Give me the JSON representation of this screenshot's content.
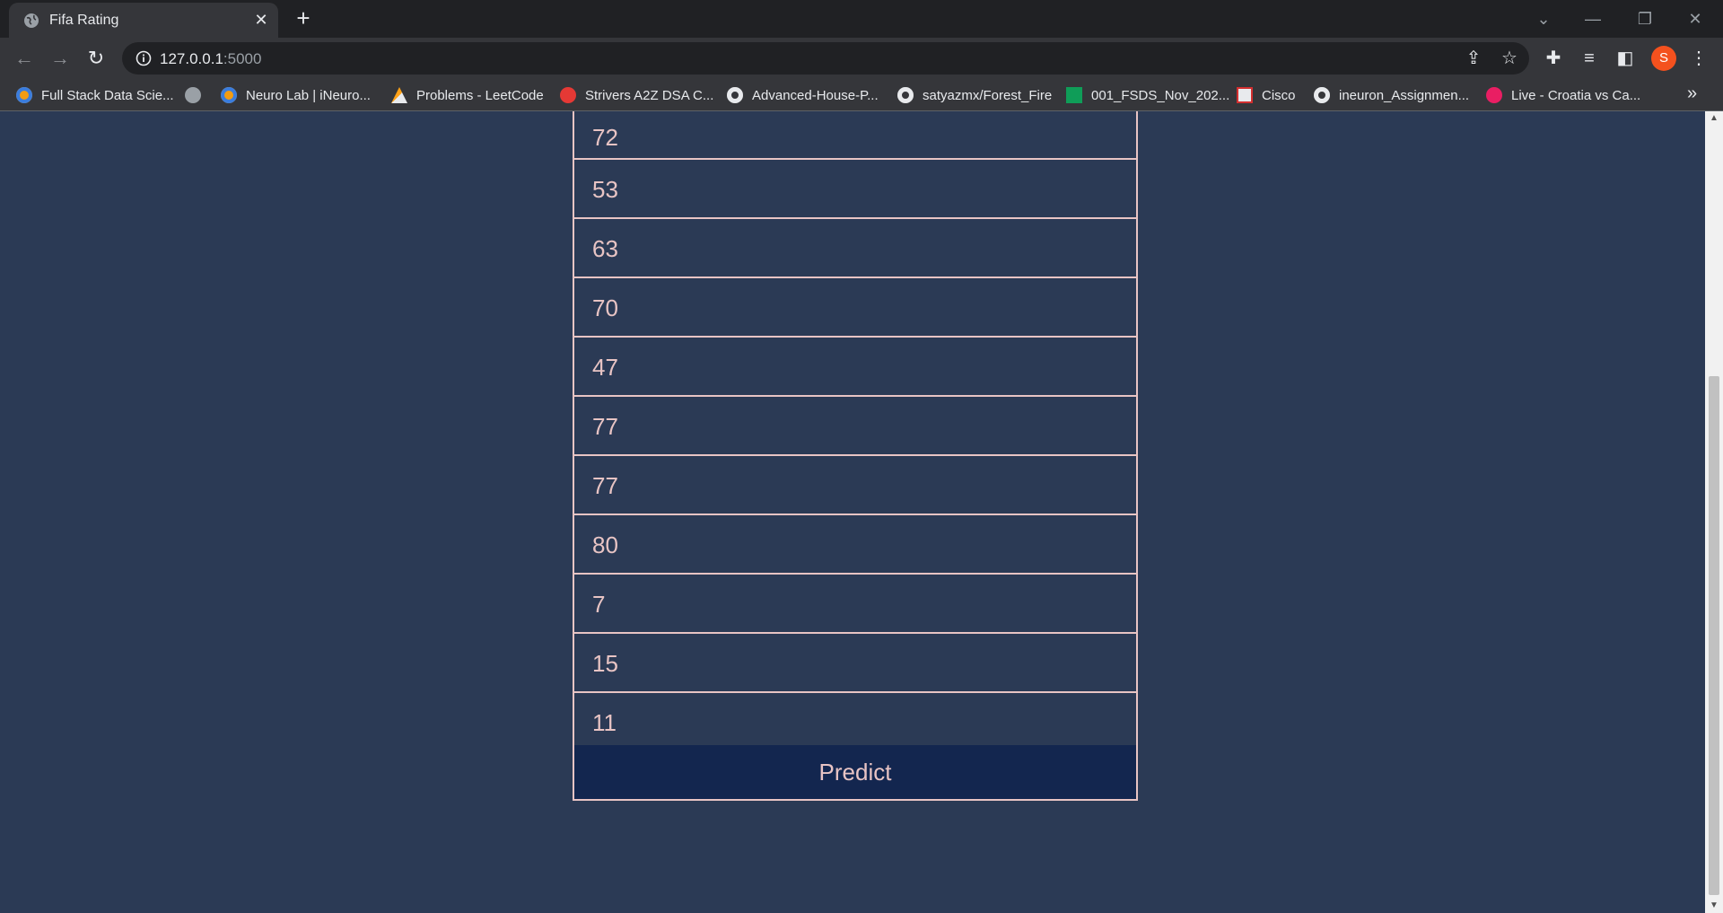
{
  "browser": {
    "tab_title": "Fifa Rating",
    "url_host": "127.0.0.1",
    "url_port": ":5000",
    "profile_initial": "S",
    "bookmarks": [
      {
        "label": "Full Stack Data Scie...",
        "icon": "ineuron-icon"
      },
      {
        "label": "",
        "icon": "globe-icon"
      },
      {
        "label": "Neuro Lab | iNeuro...",
        "icon": "ineuron-icon"
      },
      {
        "label": "Problems - LeetCode",
        "icon": "leetcode-icon"
      },
      {
        "label": "Strivers A2Z DSA C...",
        "icon": "tuf-icon"
      },
      {
        "label": "Advanced-House-P...",
        "icon": "github-icon"
      },
      {
        "label": "satyazmx/Forest_Fire",
        "icon": "github-icon"
      },
      {
        "label": "001_FSDS_Nov_202...",
        "icon": "sheets-icon"
      },
      {
        "label": "Cisco",
        "icon": "cisco-icon"
      },
      {
        "label": "ineuron_Assignmen...",
        "icon": "github-icon"
      },
      {
        "label": "Live - Croatia vs Ca...",
        "icon": "live-icon"
      }
    ],
    "more_bookmarks": "»"
  },
  "form": {
    "fields": [
      "72",
      "53",
      "63",
      "70",
      "47",
      "77",
      "77",
      "80",
      "7",
      "15",
      "11"
    ],
    "submit_label": "Predict"
  },
  "colors": {
    "page_bg": "#2b3a55",
    "border": "#e8c4c4",
    "button_bg": "#13264f",
    "avatar": "#f4511e"
  }
}
